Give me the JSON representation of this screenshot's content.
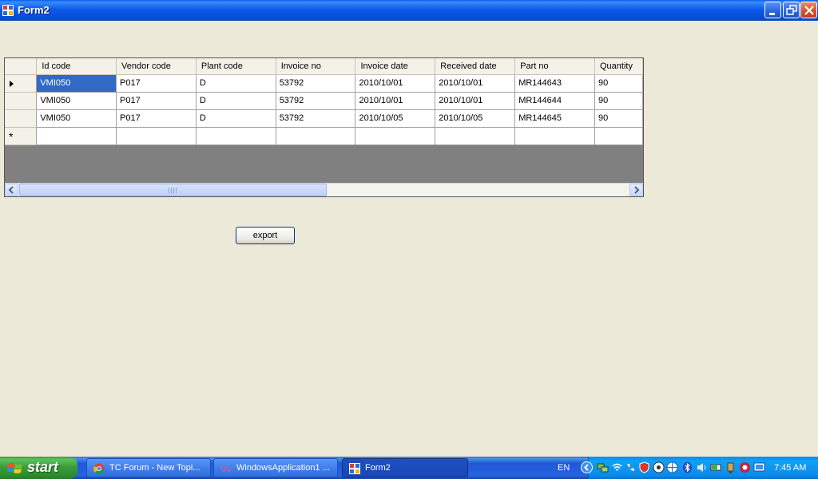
{
  "window": {
    "title": "Form2"
  },
  "grid": {
    "columns": [
      "Id code",
      "Vendor code",
      "Plant code",
      "Invoice no",
      "Invoice date",
      "Received date",
      "Part no",
      "Quantity"
    ],
    "rows": [
      [
        "VMI050",
        "P017",
        "D",
        "53792",
        "2010/10/01",
        "2010/10/01",
        "MR144643",
        "90"
      ],
      [
        "VMI050",
        "P017",
        "D",
        "53792",
        "2010/10/01",
        "2010/10/01",
        "MR144644",
        "90"
      ],
      [
        "VMI050",
        "P017",
        "D",
        "53792",
        "2010/10/05",
        "2010/10/05",
        "MR144645",
        "90"
      ]
    ],
    "new_row_marker": "*"
  },
  "buttons": {
    "export": "export"
  },
  "taskbar": {
    "start": "start",
    "tasks": [
      "TC Forum - New Topi...",
      "WindowsApplication1 ...",
      "Form2"
    ],
    "language": "EN",
    "clock": "7:45 AM"
  },
  "colors": {
    "selection": "#316AC5",
    "titlebar": "#0A5FEF",
    "form_bg": "#ECE9D8",
    "grid_bg": "#808080"
  }
}
